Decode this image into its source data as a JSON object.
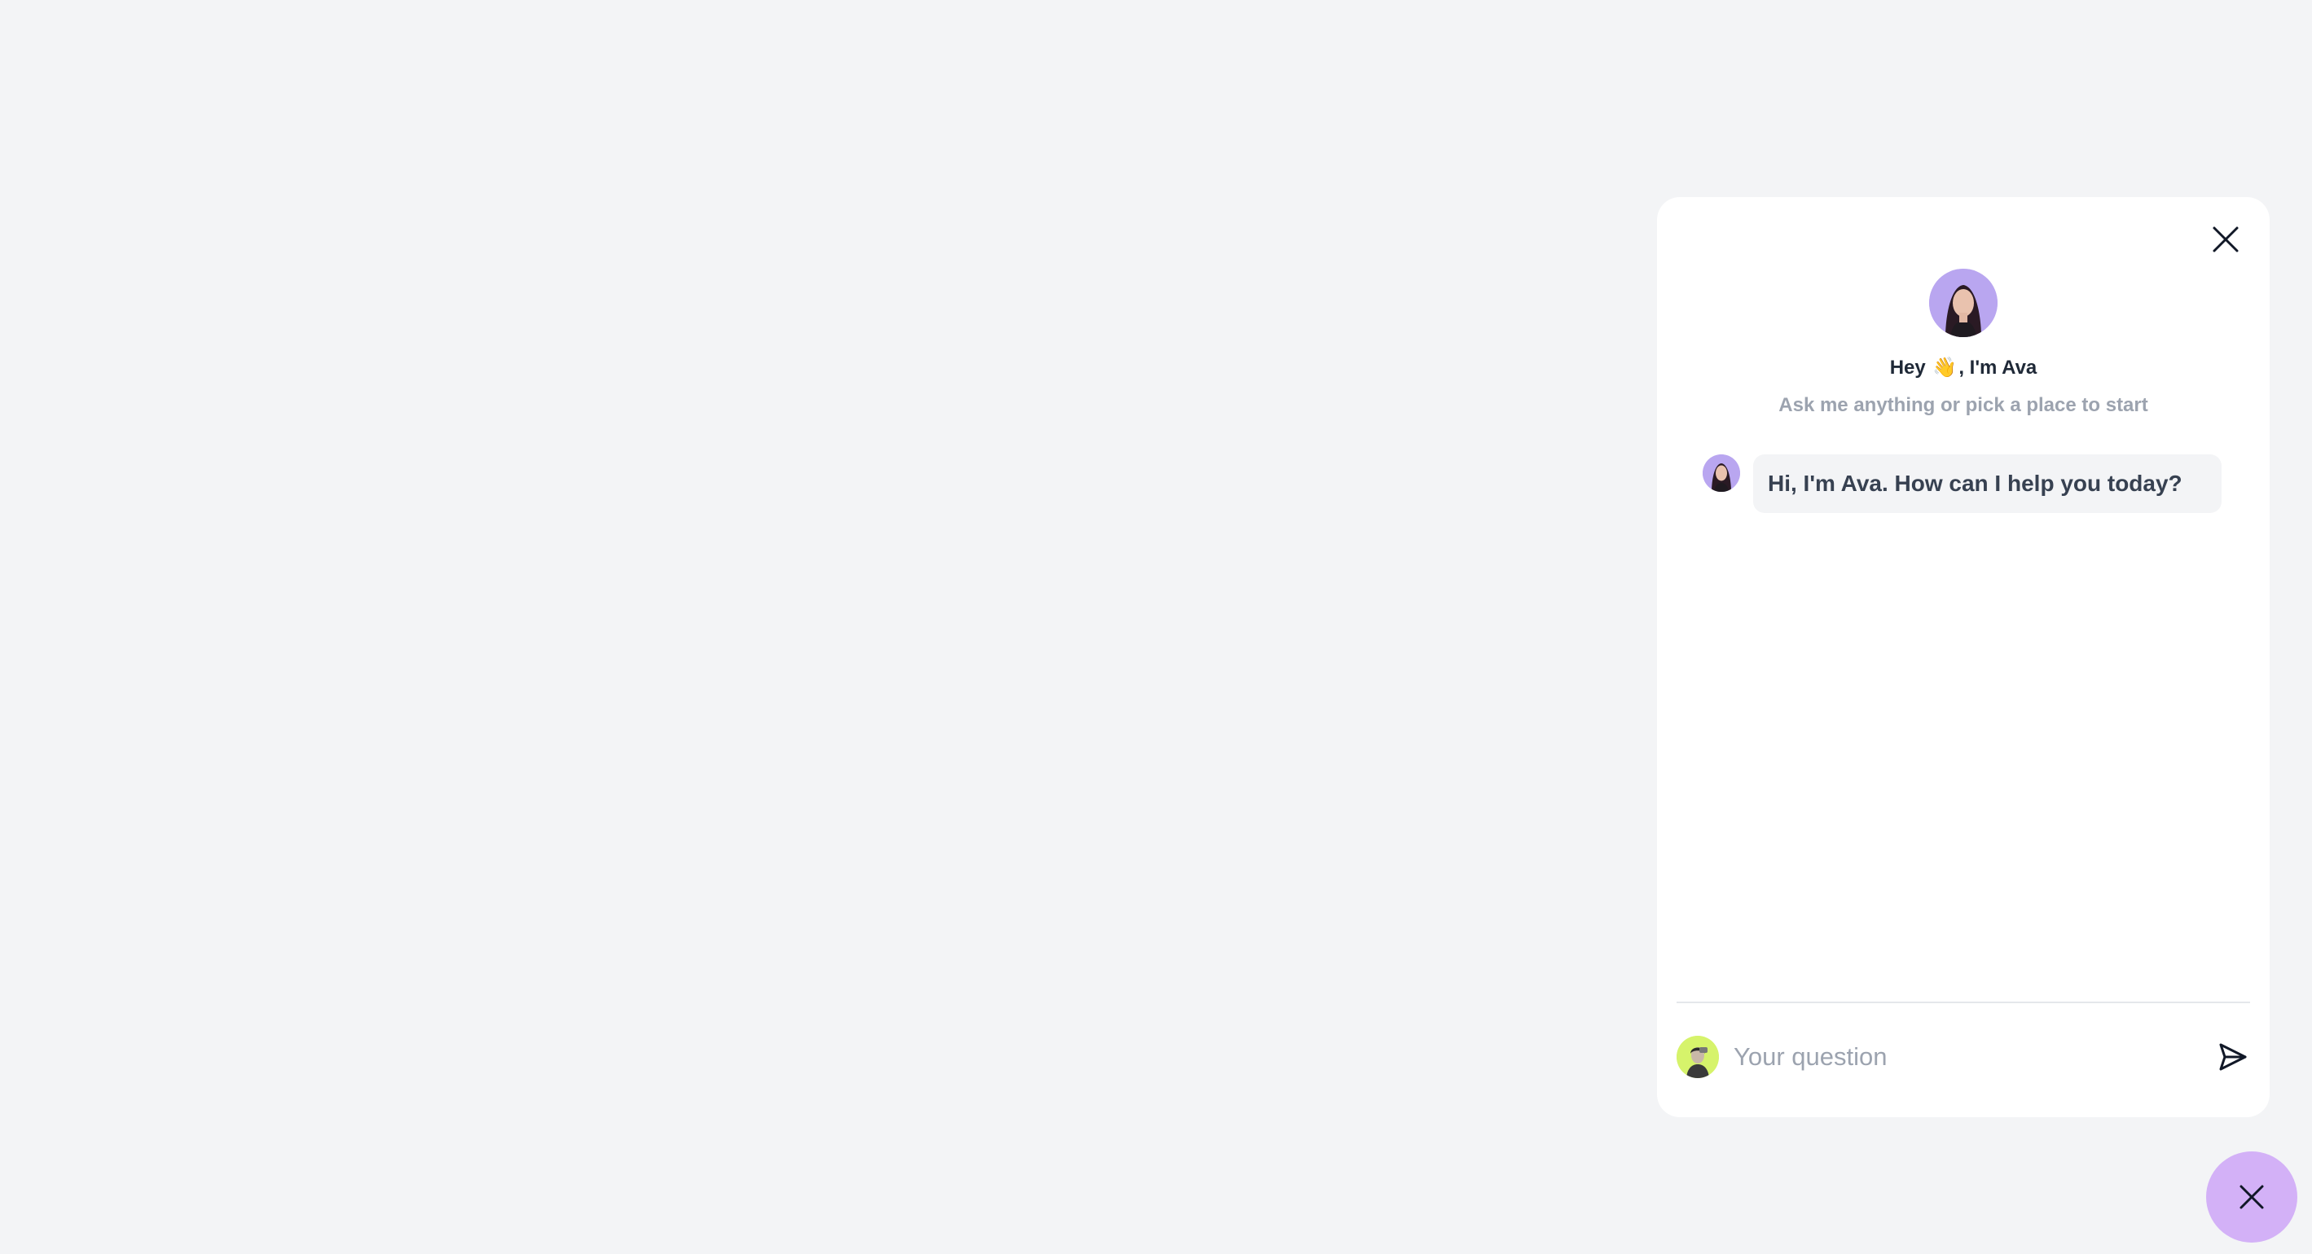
{
  "chat": {
    "greeting_prefix": "Hey",
    "greeting_suffix": ", I'm Ava",
    "subtitle": "Ask me anything or pick a place to start",
    "messages": [
      {
        "sender": "Ava",
        "text": "Hi, I'm Ava. How can I help you today?"
      }
    ],
    "input": {
      "placeholder": "Your question",
      "value": ""
    }
  },
  "icons": {
    "close": "close-icon",
    "wave": "waving-hand-icon",
    "send": "send-icon",
    "fab": "close-icon"
  },
  "colors": {
    "page_background": "#f3f4f6",
    "panel_background": "#ffffff",
    "assistant_avatar": "#b9a6f0",
    "user_avatar": "#d6f36b",
    "fab_background": "#d3b1f7",
    "bubble_background": "#f3f4f6"
  }
}
